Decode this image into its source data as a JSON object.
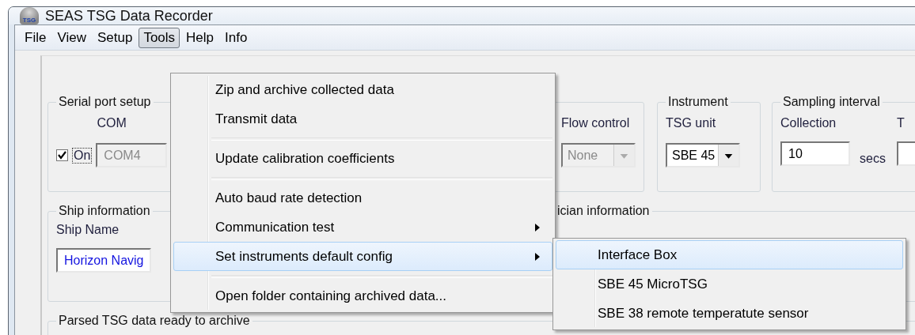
{
  "window": {
    "title": "SEAS TSG Data Recorder",
    "logo_text": "TSG"
  },
  "menu_bar": [
    {
      "label": "File",
      "selected": false
    },
    {
      "label": "View",
      "selected": false
    },
    {
      "label": "Setup",
      "selected": false
    },
    {
      "label": "Tools",
      "selected": true
    },
    {
      "label": "Help",
      "selected": false
    },
    {
      "label": "Info",
      "selected": false
    }
  ],
  "serial_port": {
    "legend": "Serial port setup",
    "com_label": "COM",
    "on": {
      "label": "On",
      "checked": true
    },
    "com_field": {
      "value": "COM4",
      "disabled": true
    },
    "flow_control": {
      "label": "Flow control",
      "value": "None",
      "disabled": true
    }
  },
  "instrument": {
    "legend": "Instrument",
    "label": "TSG unit",
    "value": "SBE 45"
  },
  "sampling": {
    "legend": "Sampling interval",
    "label": "Collection",
    "value": "10",
    "unit": "secs",
    "next_label": "T"
  },
  "ship": {
    "legend": "Ship information",
    "label": "Ship Name",
    "value": "Horizon Navig"
  },
  "technician": {
    "legend": "ician information"
  },
  "parsed": {
    "legend": "Parsed TSG data ready to archive"
  },
  "tools_menu": {
    "items": [
      {
        "kind": "item",
        "label": "Zip and archive collected data",
        "submenu": false,
        "selected": false
      },
      {
        "kind": "item",
        "label": "Transmit data",
        "submenu": false,
        "selected": false
      },
      {
        "kind": "separator"
      },
      {
        "kind": "item",
        "label": "Update calibration coefficients",
        "submenu": false,
        "selected": false
      },
      {
        "kind": "separator"
      },
      {
        "kind": "item",
        "label": "Auto baud rate detection",
        "submenu": false,
        "selected": false
      },
      {
        "kind": "item",
        "label": "Communication test",
        "submenu": true,
        "selected": false
      },
      {
        "kind": "item",
        "label": "Set instruments default config",
        "submenu": true,
        "selected": true
      },
      {
        "kind": "separator"
      },
      {
        "kind": "item",
        "label": "Open folder containing archived data...",
        "submenu": false,
        "selected": false
      }
    ]
  },
  "submenu": {
    "items": [
      {
        "label": "Interface Box",
        "selected": true
      },
      {
        "label": "SBE 45 MicroTSG",
        "selected": false
      },
      {
        "label": "SBE 38 remote temperatute sensor",
        "selected": false
      }
    ]
  }
}
